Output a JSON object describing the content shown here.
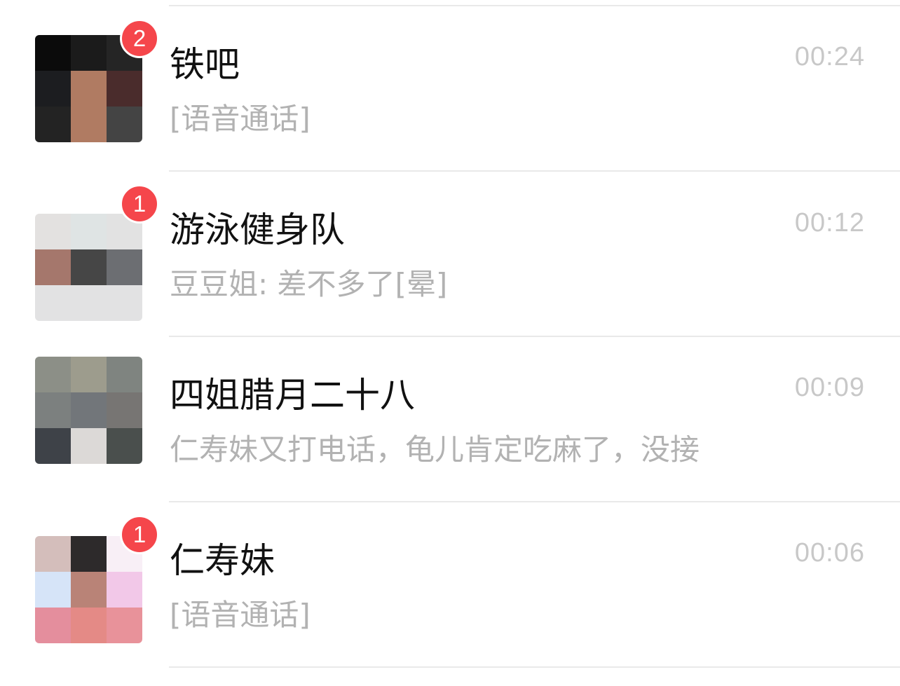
{
  "chats": [
    {
      "name": "铁吧",
      "time": "00:24",
      "preview": "[语音通话]",
      "unread": "2",
      "avatar_colors": [
        "#0b0b0b",
        "#1b1b1b",
        "#252525",
        "#1c1d20",
        "#b07b62",
        "#4a2c2c",
        "#232323",
        "#b07b62",
        "#444444"
      ]
    },
    {
      "name": "游泳健身队",
      "time": "00:12",
      "preview": "豆豆姐: 差不多了[晕]",
      "unread": "1",
      "avatar_colors": [
        "#e3e1e0",
        "#dfe4e4",
        "#e2e2e2",
        "#a5776c",
        "#464646",
        "#6c6e72",
        "#e2e2e3",
        "#e2e2e3",
        "#e2e2e3"
      ]
    },
    {
      "name": "四姐腊月二十八",
      "time": "00:09",
      "preview": "仁寿妹又打电话，龟儿肯定吃麻了，没接",
      "unread": "",
      "avatar_colors": [
        "#8c8f87",
        "#9d9c8d",
        "#7f8480",
        "#7c807f",
        "#72767a",
        "#777573",
        "#3e4248",
        "#dcd9d7",
        "#4a4f4d"
      ]
    },
    {
      "name": "仁寿妹",
      "time": "00:06",
      "preview": "[语音通话]",
      "unread": "1",
      "avatar_colors": [
        "#d4bebb",
        "#2d2a2b",
        "#f8eff6",
        "#d6e4f8",
        "#b98377",
        "#f2c8e8",
        "#e48e9d",
        "#e48a86",
        "#e8929a"
      ]
    }
  ]
}
